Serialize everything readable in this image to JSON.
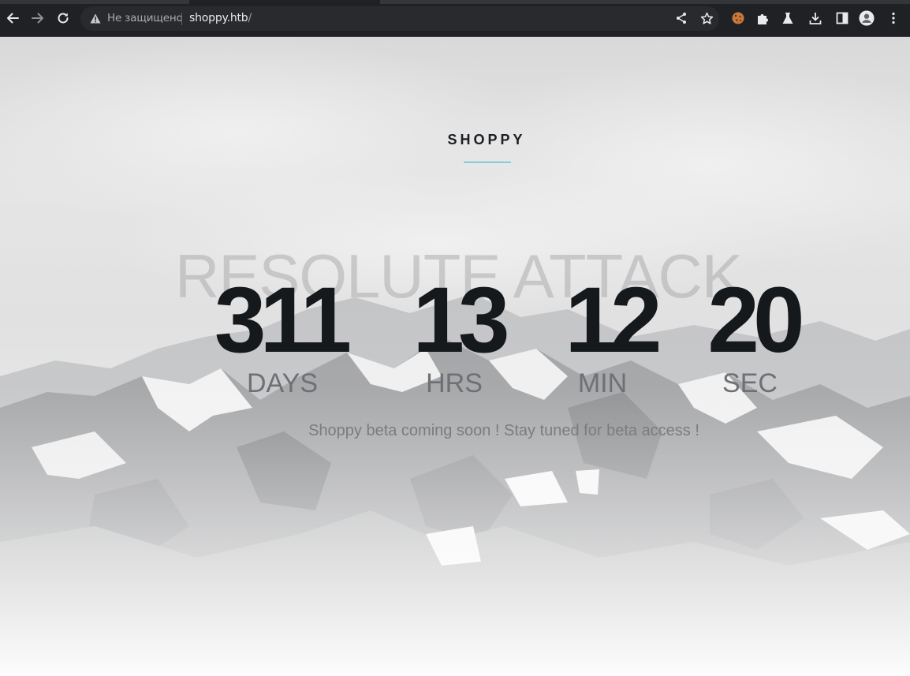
{
  "browser": {
    "security_label": "Не защищено",
    "url_host": "shoppy.htb",
    "url_path": "/",
    "icons": [
      "back-icon",
      "forward-icon",
      "reload-icon",
      "warning-icon",
      "share-icon",
      "star-icon",
      "cookie-extension-icon",
      "puzzle-extensions-icon",
      "flask-labs-icon",
      "download-icon",
      "side-panel-icon",
      "profile-icon",
      "kebab-menu-icon"
    ]
  },
  "page": {
    "brand": "SHOPPY",
    "ghost_text": "RESOLUTE ATTACK",
    "countdown": [
      {
        "value": "311",
        "label": "DAYS"
      },
      {
        "value": "13",
        "label": "HRS"
      },
      {
        "value": "12",
        "label": "MIN"
      },
      {
        "value": "20",
        "label": "SEC"
      }
    ],
    "tagline": "Shoppy beta coming soon ! Stay tuned for beta access !",
    "accent_color": "#1ab3c9"
  }
}
